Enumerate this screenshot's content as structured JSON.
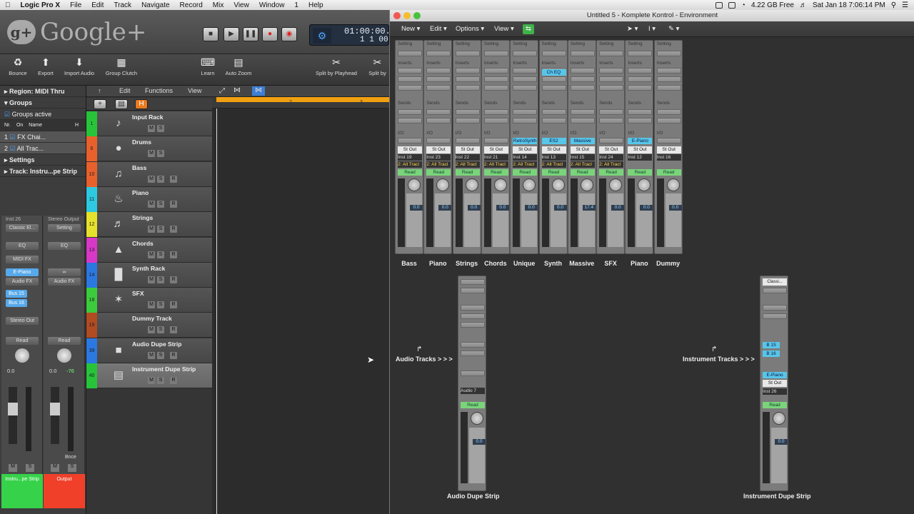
{
  "menubar": {
    "app": "Logic Pro X",
    "items": [
      "File",
      "Edit",
      "Track",
      "Navigate",
      "Record",
      "Mix",
      "View",
      "Window",
      "1",
      "Help"
    ],
    "disk": "4.22 GB Free",
    "clock": "Sat Jan 18  7:06:14 PM"
  },
  "overlay": {
    "text": "Google+"
  },
  "transport": {
    "time": "01:00:00.00",
    "bars": "1  1  00"
  },
  "toolbar": {
    "items": [
      "Bounce",
      "Export",
      "Import Audio",
      "Group Clutch",
      "Learn",
      "Auto Zoom",
      "Split by Playhead",
      "Split by"
    ]
  },
  "inspector": {
    "region": "Region: MIDI Thru",
    "groups": "Groups",
    "groups_active": "Groups active",
    "cols": [
      "Nr.",
      "On",
      "Name",
      "H"
    ],
    "group_rows": [
      {
        "nr": "1",
        "name": "FX Chai..."
      },
      {
        "nr": "2",
        "name": "All Trac..."
      }
    ],
    "settings": "Settings",
    "track": "Track:  Instru...pe Strip",
    "strip1": {
      "top": "Inst 26",
      "setting": "Classic El...",
      "eq": "EQ",
      "midifx": "MIDI FX",
      "plugin": "E-Piano",
      "audiofx": "Audio FX",
      "bus1": "Bus 15",
      "bus2": "Bus 16",
      "out": "Stereo Out",
      "read": "Read",
      "val": "0.0",
      "m": "M",
      "s": "S",
      "name": "Instru...pe Strip"
    },
    "strip2": {
      "top": "Stereo Output",
      "setting": "Setting",
      "eq": "EQ",
      "audiofx": "Audio FX",
      "read": "Read",
      "val": "0.0",
      "val2": "-76",
      "m": "M",
      "s": "S",
      "bnce": "Bnce",
      "name": "Output"
    }
  },
  "trackheader": {
    "edit": "Edit",
    "functions": "Functions",
    "view": "View"
  },
  "tracks": [
    {
      "n": "1",
      "name": "Input Rack",
      "color": "#27c43a"
    },
    {
      "n": "6",
      "name": "Drums",
      "color": "#e8612c"
    },
    {
      "n": "10",
      "name": "Bass",
      "color": "#e8612c"
    },
    {
      "n": "11",
      "name": "Piano",
      "color": "#2dc9e0"
    },
    {
      "n": "12",
      "name": "Strings",
      "color": "#e6e12a"
    },
    {
      "n": "13",
      "name": "Chords",
      "color": "#d838c8"
    },
    {
      "n": "14",
      "name": "Synth Rack",
      "color": "#2b78e0"
    },
    {
      "n": "18",
      "name": "SFX",
      "color": "#3ccb3c"
    },
    {
      "n": "19",
      "name": "Dummy Track",
      "color": "#b04b22"
    },
    {
      "n": "39",
      "name": "Audio Dupe Strip",
      "color": "#2b78e0"
    },
    {
      "n": "40",
      "name": "Instrument Dupe Strip",
      "color": "#27c43a"
    }
  ],
  "ruler": {
    "marks": [
      "2",
      "3"
    ]
  },
  "env": {
    "title": "Untitled 5 - Komplete Kontrol - Environment",
    "menus": [
      "New",
      "Edit",
      "Options",
      "View"
    ],
    "channels": [
      {
        "name": "Bass",
        "inst": "Inst 19",
        "grp": "2: All Tracl",
        "plugin": "",
        "val": "0.0"
      },
      {
        "name": "Piano",
        "inst": "Inst 23",
        "grp": "2: All Tracl",
        "plugin": "",
        "val": "0.0"
      },
      {
        "name": "Strings",
        "inst": "Inst 22",
        "grp": "2: All Tracl",
        "plugin": "",
        "val": "0.0"
      },
      {
        "name": "Chords",
        "inst": "Inst 21",
        "grp": "2: All Tracl",
        "plugin": "",
        "val": "0.0"
      },
      {
        "name": "Unique",
        "inst": "Inst 14",
        "grp": "2: All Tracl",
        "plugin": "RetroSynth",
        "val": "0.0"
      },
      {
        "name": "Synth",
        "inst": "Inst 13",
        "grp": "2: All Tracl",
        "plugin": "ES2",
        "val": "0.0",
        "chEq": "Ch EQ"
      },
      {
        "name": "Massive",
        "inst": "Inst 15",
        "grp": "2: All Tracl",
        "plugin": "Massive",
        "val": "17.4"
      },
      {
        "name": "SFX",
        "inst": "Inst 24",
        "grp": "2: All Tracl",
        "plugin": "",
        "val": "0.0"
      },
      {
        "name": "Piano",
        "inst": "Inst 12",
        "grp": "",
        "plugin": "E-Piano",
        "val": "0.0"
      },
      {
        "name": "Dummy",
        "inst": "Inst 16",
        "grp": "",
        "plugin": "",
        "val": "0.0"
      }
    ],
    "labels": {
      "setting": "Setting",
      "eq": "EQ",
      "inserts": "Inserts",
      "sends": "Sends",
      "io": "I/O",
      "stout": "St Out",
      "read": "Read"
    },
    "audio_tracks": "Audio Tracks > > >",
    "instrument_tracks": "Instrument Tracks > > >",
    "audio_dupe": {
      "name": "Audio Dupe Strip",
      "inst": "Audio 7",
      "val": "0.0"
    },
    "inst_dupe": {
      "name": "Instrument Dupe Strip",
      "setting": "Classi...",
      "inst": "Inst 26",
      "b1": "B 15",
      "b2": "B 16",
      "plugin": "E-Piano",
      "val": "0.0"
    }
  }
}
